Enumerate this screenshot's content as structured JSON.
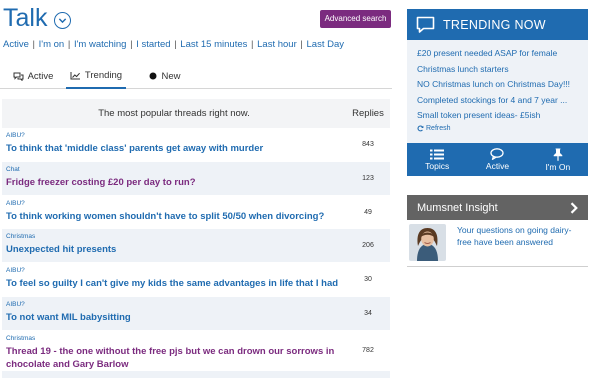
{
  "page": {
    "title": "Talk",
    "advanced_search_label": "Advanced search"
  },
  "filters": [
    "Active",
    "I'm on",
    "I'm watching",
    "I started",
    "Last 15 minutes",
    "Last hour",
    "Last Day"
  ],
  "tabs": [
    {
      "label": "Active",
      "icon": "chat-bubbles-icon"
    },
    {
      "label": "Trending",
      "icon": "trending-chart-icon",
      "selected": true
    },
    {
      "label": "New",
      "icon": "dot-icon"
    }
  ],
  "table": {
    "header_description": "The most popular threads right now.",
    "header_replies": "Replies",
    "rows": [
      {
        "category": "AIBU?",
        "title": "To think that 'middle class' parents get away with murder",
        "replies": "843",
        "visited": false
      },
      {
        "category": "Chat",
        "title": "Fridge freezer costing £20 per day to run?",
        "replies": "123",
        "visited": true
      },
      {
        "category": "AIBU?",
        "title": "To think working women shouldn't have to split 50/50 when divorcing?",
        "replies": "49",
        "visited": false
      },
      {
        "category": "Christmas",
        "title": "Unexpected hit presents",
        "replies": "206",
        "visited": false
      },
      {
        "category": "AIBU?",
        "title": "To feel so guilty I can't give my kids the same advantages in life that I had",
        "replies": "30",
        "visited": false
      },
      {
        "category": "AIBU?",
        "title": "To not want MIL babysitting",
        "replies": "34",
        "visited": false
      },
      {
        "category": "Christmas",
        "title": "Thread 19 - the one without the free pjs but we can drown our sorrows in chocolate and Gary Barlow",
        "replies": "782",
        "visited": true
      }
    ]
  },
  "trending_now": {
    "title": "TRENDING NOW",
    "items": [
      "£20 present needed ASAP for female",
      "Christmas lunch starters",
      "NO Christmas lunch on Christmas Day!!!",
      "Completed stockings for 4 and 7 year ...",
      "Small token present ideas- £5ish"
    ],
    "refresh_label": "Refresh"
  },
  "nav": [
    {
      "label": "Topics",
      "icon": "list-icon"
    },
    {
      "label": "Active",
      "icon": "chat-bubble-icon"
    },
    {
      "label": "I'm On",
      "icon": "pin-icon"
    }
  ],
  "insight": {
    "title": "Mumsnet Insight",
    "text": "Your questions on going dairy-free have been answered"
  },
  "colors": {
    "brand_blue": "#1f6bb0",
    "accent_purple": "#7b2b7f",
    "row_alt": "#eef2f7",
    "insight_grey": "#636363"
  }
}
